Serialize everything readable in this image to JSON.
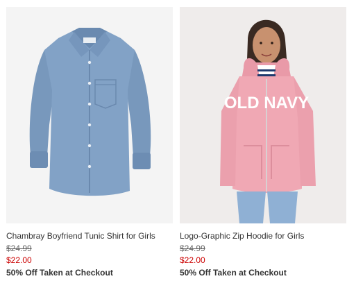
{
  "products": [
    {
      "name": "Chambray Boyfriend Tunic Shirt for Girls",
      "original_price": "$24.99",
      "sale_price": "$22.00",
      "promo": "50% Off Taken at Checkout"
    },
    {
      "name": "Logo-Graphic Zip Hoodie for Girls",
      "original_price": "$24.99",
      "sale_price": "$22.00",
      "promo": "50% Off Taken at Checkout",
      "garment_print": "OLD NAVY"
    }
  ],
  "colors": {
    "sale_price": "#cc0000",
    "chambray": "#7f9fc2",
    "hoodie": "#f0a8b4"
  }
}
